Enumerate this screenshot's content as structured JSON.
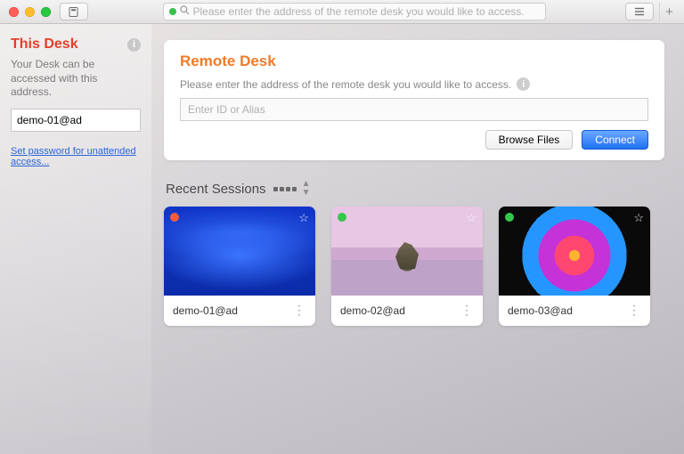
{
  "titlebar": {
    "address_placeholder": "Please enter the address of the remote desk you would like to access."
  },
  "sidebar": {
    "title": "This Desk",
    "desc": "Your Desk can be accessed with this address.",
    "address_value": "demo-01@ad",
    "link": "Set password for unattended access..."
  },
  "remote": {
    "title": "Remote Desk",
    "desc": "Please enter the address of the remote desk you would like to access.",
    "input_placeholder": "Enter ID or Alias",
    "browse_label": "Browse Files",
    "connect_label": "Connect"
  },
  "recent": {
    "title": "Recent Sessions",
    "items": [
      {
        "name": "demo-01@ad",
        "status": "offline"
      },
      {
        "name": "demo-02@ad",
        "status": "online"
      },
      {
        "name": "demo-03@ad",
        "status": "online"
      }
    ]
  },
  "status_colors": {
    "online": "#34c749",
    "offline": "#ff5a3c"
  }
}
